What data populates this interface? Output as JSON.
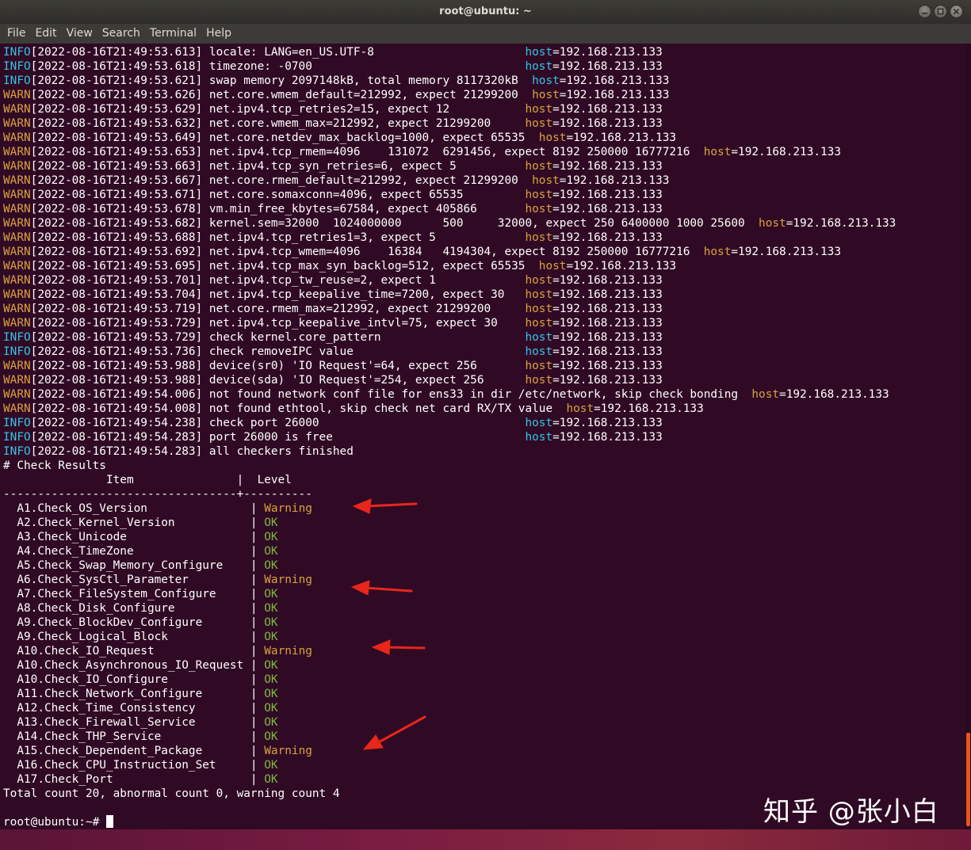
{
  "window": {
    "title": "root@ubuntu: ~"
  },
  "icons": {
    "minimize": "minimize-icon",
    "maximize": "maximize-icon",
    "close": "close-icon"
  },
  "menu": [
    "File",
    "Edit",
    "View",
    "Search",
    "Terminal",
    "Help"
  ],
  "colors": {
    "background": "#300a24",
    "info": "#34c3e8",
    "warn": "#d9a23f",
    "ok": "#7fb93f",
    "arrow": "#e8261c",
    "scroll_thumb": "#e95420"
  },
  "log": [
    {
      "level": "INFO",
      "ts": "[2022-08-16T21:49:53.613]",
      "msg": "locale: LANG=en_US.UTF-8",
      "host": "192.168.213.133",
      "host_col": 76
    },
    {
      "level": "INFO",
      "ts": "[2022-08-16T21:49:53.618]",
      "msg": "timezone: -0700",
      "host": "192.168.213.133",
      "host_col": 76
    },
    {
      "level": "INFO",
      "ts": "[2022-08-16T21:49:53.621]",
      "msg": "swap memory 2097148kB, total memory 8117320kB",
      "host": "192.168.213.133",
      "host_col": 77
    },
    {
      "level": "WARN",
      "ts": "[2022-08-16T21:49:53.626]",
      "msg": "net.core.wmem_default=212992, expect 21299200",
      "host": "192.168.213.133",
      "host_col": 77
    },
    {
      "level": "WARN",
      "ts": "[2022-08-16T21:49:53.629]",
      "msg": "net.ipv4.tcp_retries2=15, expect 12",
      "host": "192.168.213.133",
      "host_col": 76
    },
    {
      "level": "WARN",
      "ts": "[2022-08-16T21:49:53.632]",
      "msg": "net.core.wmem_max=212992, expect 21299200",
      "host": "192.168.213.133",
      "host_col": 76
    },
    {
      "level": "WARN",
      "ts": "[2022-08-16T21:49:53.649]",
      "msg": "net.core.netdev_max_backlog=1000, expect 65535",
      "host": "192.168.213.133",
      "host_col": 78
    },
    {
      "level": "WARN",
      "ts": "[2022-08-16T21:49:53.653]",
      "msg": "net.ipv4.tcp_rmem=4096    131072  6291456, expect 8192 250000 16777216",
      "host": "192.168.213.133",
      "host_col": 102
    },
    {
      "level": "WARN",
      "ts": "[2022-08-16T21:49:53.663]",
      "msg": "net.ipv4.tcp_syn_retries=6, expect 5",
      "host": "192.168.213.133",
      "host_col": 76
    },
    {
      "level": "WARN",
      "ts": "[2022-08-16T21:49:53.667]",
      "msg": "net.core.rmem_default=212992, expect 21299200",
      "host": "192.168.213.133",
      "host_col": 77
    },
    {
      "level": "WARN",
      "ts": "[2022-08-16T21:49:53.671]",
      "msg": "net.core.somaxconn=4096, expect 65535",
      "host": "192.168.213.133",
      "host_col": 76
    },
    {
      "level": "WARN",
      "ts": "[2022-08-16T21:49:53.678]",
      "msg": "vm.min_free_kbytes=67584, expect 405866",
      "host": "192.168.213.133",
      "host_col": 76
    },
    {
      "level": "WARN",
      "ts": "[2022-08-16T21:49:53.682]",
      "msg": "kernel.sem=32000  1024000000      500     32000, expect 250 6400000 1000 25600",
      "host": "192.168.213.133",
      "host_col": 110
    },
    {
      "level": "WARN",
      "ts": "[2022-08-16T21:49:53.688]",
      "msg": "net.ipv4.tcp_retries1=3, expect 5",
      "host": "192.168.213.133",
      "host_col": 76
    },
    {
      "level": "WARN",
      "ts": "[2022-08-16T21:49:53.692]",
      "msg": "net.ipv4.tcp_wmem=4096    16384   4194304, expect 8192 250000 16777216",
      "host": "192.168.213.133",
      "host_col": 102
    },
    {
      "level": "WARN",
      "ts": "[2022-08-16T21:49:53.695]",
      "msg": "net.ipv4.tcp_max_syn_backlog=512, expect 65535",
      "host": "192.168.213.133",
      "host_col": 78
    },
    {
      "level": "WARN",
      "ts": "[2022-08-16T21:49:53.701]",
      "msg": "net.ipv4.tcp_tw_reuse=2, expect 1",
      "host": "192.168.213.133",
      "host_col": 76
    },
    {
      "level": "WARN",
      "ts": "[2022-08-16T21:49:53.704]",
      "msg": "net.ipv4.tcp_keepalive_time=7200, expect 30",
      "host": "192.168.213.133",
      "host_col": 76
    },
    {
      "level": "WARN",
      "ts": "[2022-08-16T21:49:53.719]",
      "msg": "net.core.rmem_max=212992, expect 21299200",
      "host": "192.168.213.133",
      "host_col": 76
    },
    {
      "level": "WARN",
      "ts": "[2022-08-16T21:49:53.729]",
      "msg": "net.ipv4.tcp_keepalive_intvl=75, expect 30",
      "host": "192.168.213.133",
      "host_col": 76
    },
    {
      "level": "INFO",
      "ts": "[2022-08-16T21:49:53.729]",
      "msg": "check kernel.core_pattern",
      "host": "192.168.213.133",
      "host_col": 76
    },
    {
      "level": "INFO",
      "ts": "[2022-08-16T21:49:53.736]",
      "msg": "check removeIPC value",
      "host": "192.168.213.133",
      "host_col": 76
    },
    {
      "level": "WARN",
      "ts": "[2022-08-16T21:49:53.988]",
      "msg": "device(sr0) 'IO Request'=64, expect 256",
      "host": "192.168.213.133",
      "host_col": 76
    },
    {
      "level": "WARN",
      "ts": "[2022-08-16T21:49:53.988]",
      "msg": "device(sda) 'IO Request'=254, expect 256",
      "host": "192.168.213.133",
      "host_col": 76
    },
    {
      "level": "WARN",
      "ts": "[2022-08-16T21:49:54.006]",
      "msg": "not found network conf file for ens33 in dir /etc/network, skip check bonding",
      "host": "192.168.213.133",
      "host_col": 109
    },
    {
      "level": "WARN",
      "ts": "[2022-08-16T21:49:54.008]",
      "msg": "not found ethtool, skip check net card RX/TX value",
      "host": "192.168.213.133",
      "host_col": 82
    },
    {
      "level": "INFO",
      "ts": "[2022-08-16T21:49:54.238]",
      "msg": "check port 26000",
      "host": "192.168.213.133",
      "host_col": 76
    },
    {
      "level": "INFO",
      "ts": "[2022-08-16T21:49:54.283]",
      "msg": "port 26000 is free",
      "host": "192.168.213.133",
      "host_col": 76
    },
    {
      "level": "INFO",
      "ts": "[2022-08-16T21:49:54.283]",
      "msg": "all checkers finished",
      "host": "",
      "host_col": 0
    }
  ],
  "results": {
    "heading": "# Check Results",
    "header_line": "               Item               |  Level",
    "separator_line": "----------------------------------+----------",
    "rows": [
      {
        "item": "  A1.Check_OS_Version              ",
        "level": "Warning"
      },
      {
        "item": "  A2.Check_Kernel_Version          ",
        "level": "OK"
      },
      {
        "item": "  A3.Check_Unicode                 ",
        "level": "OK"
      },
      {
        "item": "  A4.Check_TimeZone                ",
        "level": "OK"
      },
      {
        "item": "  A5.Check_Swap_Memory_Configure   ",
        "level": "OK"
      },
      {
        "item": "  A6.Check_SysCtl_Parameter        ",
        "level": "Warning"
      },
      {
        "item": "  A7.Check_FileSystem_Configure    ",
        "level": "OK"
      },
      {
        "item": "  A8.Check_Disk_Configure          ",
        "level": "OK"
      },
      {
        "item": "  A9.Check_BlockDev_Configure      ",
        "level": "OK"
      },
      {
        "item": "  A9.Check_Logical_Block           ",
        "level": "OK"
      },
      {
        "item": "  A10.Check_IO_Request             ",
        "level": "Warning"
      },
      {
        "item": "  A10.Check_Asynchronous_IO_Request",
        "level": "OK"
      },
      {
        "item": "  A10.Check_IO_Configure           ",
        "level": "OK"
      },
      {
        "item": "  A11.Check_Network_Configure      ",
        "level": "OK"
      },
      {
        "item": "  A12.Check_Time_Consistency       ",
        "level": "OK"
      },
      {
        "item": "  A13.Check_Firewall_Service       ",
        "level": "OK"
      },
      {
        "item": "  A14.Check_THP_Service            ",
        "level": "OK"
      },
      {
        "item": "  A15.Check_Dependent_Package      ",
        "level": "Warning"
      },
      {
        "item": "  A16.Check_CPU_Instruction_Set    ",
        "level": "OK"
      },
      {
        "item": "  A17.Check_Port                   ",
        "level": "OK"
      }
    ],
    "total_line": "Total count 20, abnormal count 0, warning count 4"
  },
  "prompt": "root@ubuntu:~# ",
  "watermark": "知乎 @张小白"
}
